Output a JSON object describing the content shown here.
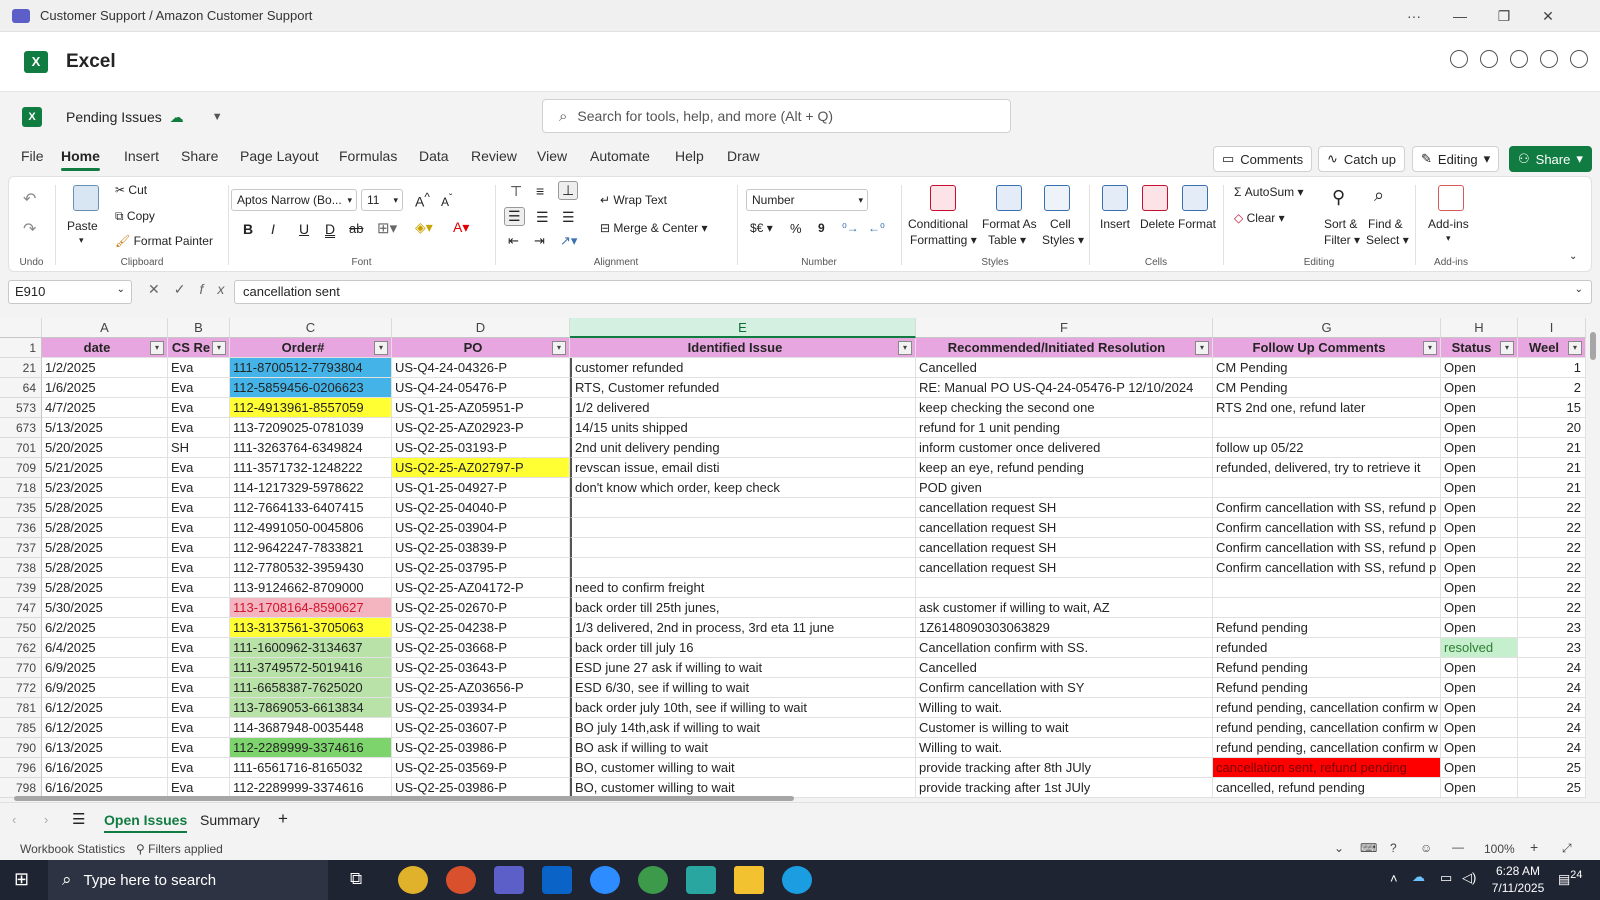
{
  "titlebar": {
    "title": "Customer Support / Amazon Customer Support",
    "more": "···",
    "minimize": "—",
    "restore": "❐",
    "close": "✕"
  },
  "app": {
    "name": "Excel",
    "logo": "X"
  },
  "doc": {
    "name": "Pending Issues",
    "doc_icon": "X"
  },
  "search": {
    "placeholder": "Search for tools, help, and more (Alt + Q)"
  },
  "menu": {
    "tabs": [
      "File",
      "Home",
      "Insert",
      "Share",
      "Page Layout",
      "Formulas",
      "Data",
      "Review",
      "View",
      "Automate",
      "Help",
      "Draw"
    ],
    "active": "Home"
  },
  "actions": {
    "comments": "Comments",
    "catchup": "Catch up",
    "editing": "Editing",
    "share": "Share"
  },
  "ribbon": {
    "undo_group": "Undo",
    "clipboard": {
      "paste": "Paste",
      "cut": "Cut",
      "copy": "Copy",
      "format_painter": "Format Painter",
      "label": "Clipboard"
    },
    "font": {
      "family": "Aptos Narrow (Bo...",
      "size": "11",
      "label": "Font",
      "bold": "B",
      "italic": "I",
      "underline": "U",
      "dunderline": "D",
      "strike": "ab"
    },
    "alignment": {
      "wrap": "Wrap Text",
      "merge": "Merge & Center",
      "label": "Alignment"
    },
    "number": {
      "format": "Number",
      "currency": "$€",
      "percent": "%",
      "comma": "9",
      "label": "Number"
    },
    "styles": {
      "conditional": "Conditional",
      "conditional2": "Formatting",
      "format_as": "Format As",
      "format_as2": "Table",
      "cell": "Cell",
      "cell2": "Styles",
      "label": "Styles"
    },
    "cells": {
      "insert": "Insert",
      "delete": "Delete",
      "format": "Format",
      "label": "Cells"
    },
    "editing": {
      "autosum": "AutoSum",
      "clear": "Clear",
      "sort": "Sort &",
      "sort2": "Filter",
      "find": "Find &",
      "find2": "Select",
      "label": "Editing"
    },
    "addins": {
      "addins": "Add-ins",
      "label": "Add-ins"
    }
  },
  "formula": {
    "namebox": "E910",
    "fx": "fx",
    "value": "cancellation sent"
  },
  "columns": [
    "A",
    "B",
    "C",
    "D",
    "E",
    "F",
    "G",
    "H",
    "I"
  ],
  "header_row": {
    "rownum": "1",
    "cells": [
      "date",
      "CS Re",
      "Order#",
      "PO",
      "Identified Issue",
      "Recommended/Initiated Resolution",
      "Follow Up Comments",
      "Status",
      "Weel"
    ]
  },
  "rows": [
    {
      "n": "21",
      "date": "1/2/2025",
      "cs": "Eva",
      "order": "111-8700512-7793804",
      "po": "US-Q4-24-04326-P",
      "issue": "customer refunded",
      "res": "Cancelled",
      "fu": "CM Pending",
      "status": "Open",
      "week": "1"
    },
    {
      "n": "64",
      "date": "1/6/2025",
      "cs": "Eva",
      "order": "112-5859456-0206623",
      "po": "US-Q4-24-05476-P",
      "issue": "RTS, Customer refunded",
      "res": "RE: Manual PO  US-Q4-24-05476-P  12/10/2024",
      "fu": "CM Pending",
      "status": "Open",
      "week": "2"
    },
    {
      "n": "573",
      "date": "4/7/2025",
      "cs": "Eva",
      "order": "112-4913961-8557059",
      "po": "US-Q1-25-AZ05951-P",
      "issue": "1/2 delivered",
      "res": "keep checking the second one",
      "fu": "RTS 2nd one, refund later",
      "status": "Open",
      "week": "15"
    },
    {
      "n": "673",
      "date": "5/13/2025",
      "cs": "Eva",
      "order": "113-7209025-0781039",
      "po": "US-Q2-25-AZ02923-P",
      "issue": "14/15 units shipped",
      "res": "refund for 1 unit pending",
      "fu": "",
      "status": "Open",
      "week": "20"
    },
    {
      "n": "701",
      "date": "5/20/2025",
      "cs": "SH",
      "order": "111-3263764-6349824",
      "po": "US-Q2-25-03193-P",
      "issue": "2nd unit delivery pending",
      "res": "inform customer once delivered",
      "fu": "follow up 05/22",
      "status": "Open",
      "week": "21"
    },
    {
      "n": "709",
      "date": "5/21/2025",
      "cs": "Eva",
      "order": "111-3571732-1248222",
      "po": "US-Q2-25-AZ02797-P",
      "issue": "revscan issue, email disti",
      "res": "keep an eye, refund pending",
      "fu": "refunded, delivered, try to retrieve it",
      "status": "Open",
      "week": "21"
    },
    {
      "n": "718",
      "date": "5/23/2025",
      "cs": "Eva",
      "order": "114-1217329-5978622",
      "po": "US-Q1-25-04927-P",
      "issue": "don't know which order, keep check",
      "res": "POD given",
      "fu": "",
      "status": "Open",
      "week": "21"
    },
    {
      "n": "735",
      "date": "5/28/2025",
      "cs": "Eva",
      "order": "112-7664133-6407415",
      "po": "US-Q2-25-04040-P",
      "issue": "",
      "res": "cancellation request SH",
      "fu": "Confirm cancellation with SS, refund p",
      "status": "Open",
      "week": "22"
    },
    {
      "n": "736",
      "date": "5/28/2025",
      "cs": "Eva",
      "order": "112-4991050-0045806",
      "po": "US-Q2-25-03904-P",
      "issue": "",
      "res": "cancellation request SH",
      "fu": "Confirm cancellation with SS, refund p",
      "status": "Open",
      "week": "22"
    },
    {
      "n": "737",
      "date": "5/28/2025",
      "cs": "Eva",
      "order": "112-9642247-7833821",
      "po": "US-Q2-25-03839-P",
      "issue": "",
      "res": "cancellation request SH",
      "fu": "Confirm cancellation with SS, refund p",
      "status": "Open",
      "week": "22"
    },
    {
      "n": "738",
      "date": "5/28/2025",
      "cs": "Eva",
      "order": "112-7780532-3959430",
      "po": "US-Q2-25-03795-P",
      "issue": "",
      "res": "cancellation request SH",
      "fu": "Confirm cancellation with SS, refund p",
      "status": "Open",
      "week": "22"
    },
    {
      "n": "739",
      "date": "5/28/2025",
      "cs": "Eva",
      "order": "113-9124662-8709000",
      "po": " US-Q2-25-AZ04172-P",
      "issue": "need to confirm freight",
      "res": "",
      "fu": "",
      "status": "Open",
      "week": "22"
    },
    {
      "n": "747",
      "date": "5/30/2025",
      "cs": "Eva",
      "order": "113-1708164-8590627",
      "po": "US-Q2-25-02670-P",
      "issue": "back order till 25th junes,",
      "res": "ask customer if willing to wait, AZ",
      "fu": "",
      "status": "Open",
      "week": "22"
    },
    {
      "n": "750",
      "date": "6/2/2025",
      "cs": "Eva",
      "order": "113-3137561-3705063",
      "po": "US-Q2-25-04238-P",
      "issue": "1/3 delivered, 2nd in process, 3rd eta 11 june",
      "res": "1Z6148090303063829",
      "fu": "Refund pending",
      "status": "Open",
      "week": "23"
    },
    {
      "n": "762",
      "date": "6/4/2025",
      "cs": "Eva",
      "order": "111-1600962-3134637",
      "po": "US-Q2-25-03668-P",
      "issue": "back order till july 16",
      "res": "Cancellation confirm with SS.",
      "fu": "refunded",
      "status": "resolved",
      "week": "23"
    },
    {
      "n": "770",
      "date": "6/9/2025",
      "cs": "Eva",
      "order": "111-3749572-5019416",
      "po": " US-Q2-25-03643-P",
      "issue": "ESD june 27 ask if willing to wait",
      "res": "Cancelled",
      "fu": "Refund pending",
      "status": "Open",
      "week": "24"
    },
    {
      "n": "772",
      "date": "6/9/2025",
      "cs": "Eva",
      "order": "111-6658387-7625020",
      "po": "US-Q2-25-AZ03656-P",
      "issue": "ESD 6/30, see if willing to wait",
      "res": "Confirm cancellation with SY",
      "fu": "Refund pending",
      "status": "Open",
      "week": "24"
    },
    {
      "n": "781",
      "date": "6/12/2025",
      "cs": "Eva",
      "order": "113-7869053-6613834",
      "po": "US-Q2-25-03934-P",
      "issue": "back order july 10th, see if willing to wait",
      "res": "Willing to wait.",
      "fu": "refund pending, cancellation confirm w",
      "status": "Open",
      "week": "24"
    },
    {
      "n": "785",
      "date": "6/12/2025",
      "cs": "Eva",
      "order": "114-3687948-0035448",
      "po": "US-Q2-25-03607-P",
      "issue": "BO july 14th,ask if willing to wait",
      "res": "Customer is willing to wait",
      "fu": "refund pending, cancellation confirm w",
      "status": "Open",
      "week": "24"
    },
    {
      "n": "790",
      "date": "6/13/2025",
      "cs": "Eva",
      "order": "112-2289999-3374616",
      "po": "US-Q2-25-03986-P",
      "issue": "BO ask if willing to wait",
      "res": "Willing to wait.",
      "fu": "refund pending, cancellation confirm w",
      "status": "Open",
      "week": "24"
    },
    {
      "n": "796",
      "date": "6/16/2025",
      "cs": "Eva",
      "order": "111-6561716-8165032",
      "po": "US-Q2-25-03569-P",
      "issue": "BO, customer willing to wait",
      "res": "provide tracking after 8th JUly",
      "fu": "cancellation sent, refund pending",
      "status": "Open",
      "week": "25"
    },
    {
      "n": "798",
      "date": "6/16/2025",
      "cs": "Eva",
      "order": "112-2289999-3374616",
      "po": "US-Q2-25-03986-P",
      "issue": "BO, customer willing to wait",
      "res": "provide tracking after 1st JUly",
      "fu": "cancelled, refund pending",
      "status": "Open",
      "week": "25"
    }
  ],
  "highlights": {
    "blue": "#44b4e8",
    "yellow": "#ffff33",
    "pink": "#f4b4c0",
    "lightgreen": "#b9e2a8",
    "green": "#7ed46c",
    "red": "#ff0000",
    "header": "#e8a6e1",
    "resolved": "#c6efce"
  },
  "sheets": {
    "tabs": [
      "Open Issues",
      "Summary"
    ],
    "active": "Open Issues",
    "add": "+"
  },
  "status": {
    "stats": "Workbook Statistics",
    "filters": "Filters applied",
    "zoom": "100%"
  },
  "taskbar": {
    "search_placeholder": "Type here to search",
    "time": "6:28 AM",
    "date": "7/11/2025",
    "notif": "24"
  }
}
